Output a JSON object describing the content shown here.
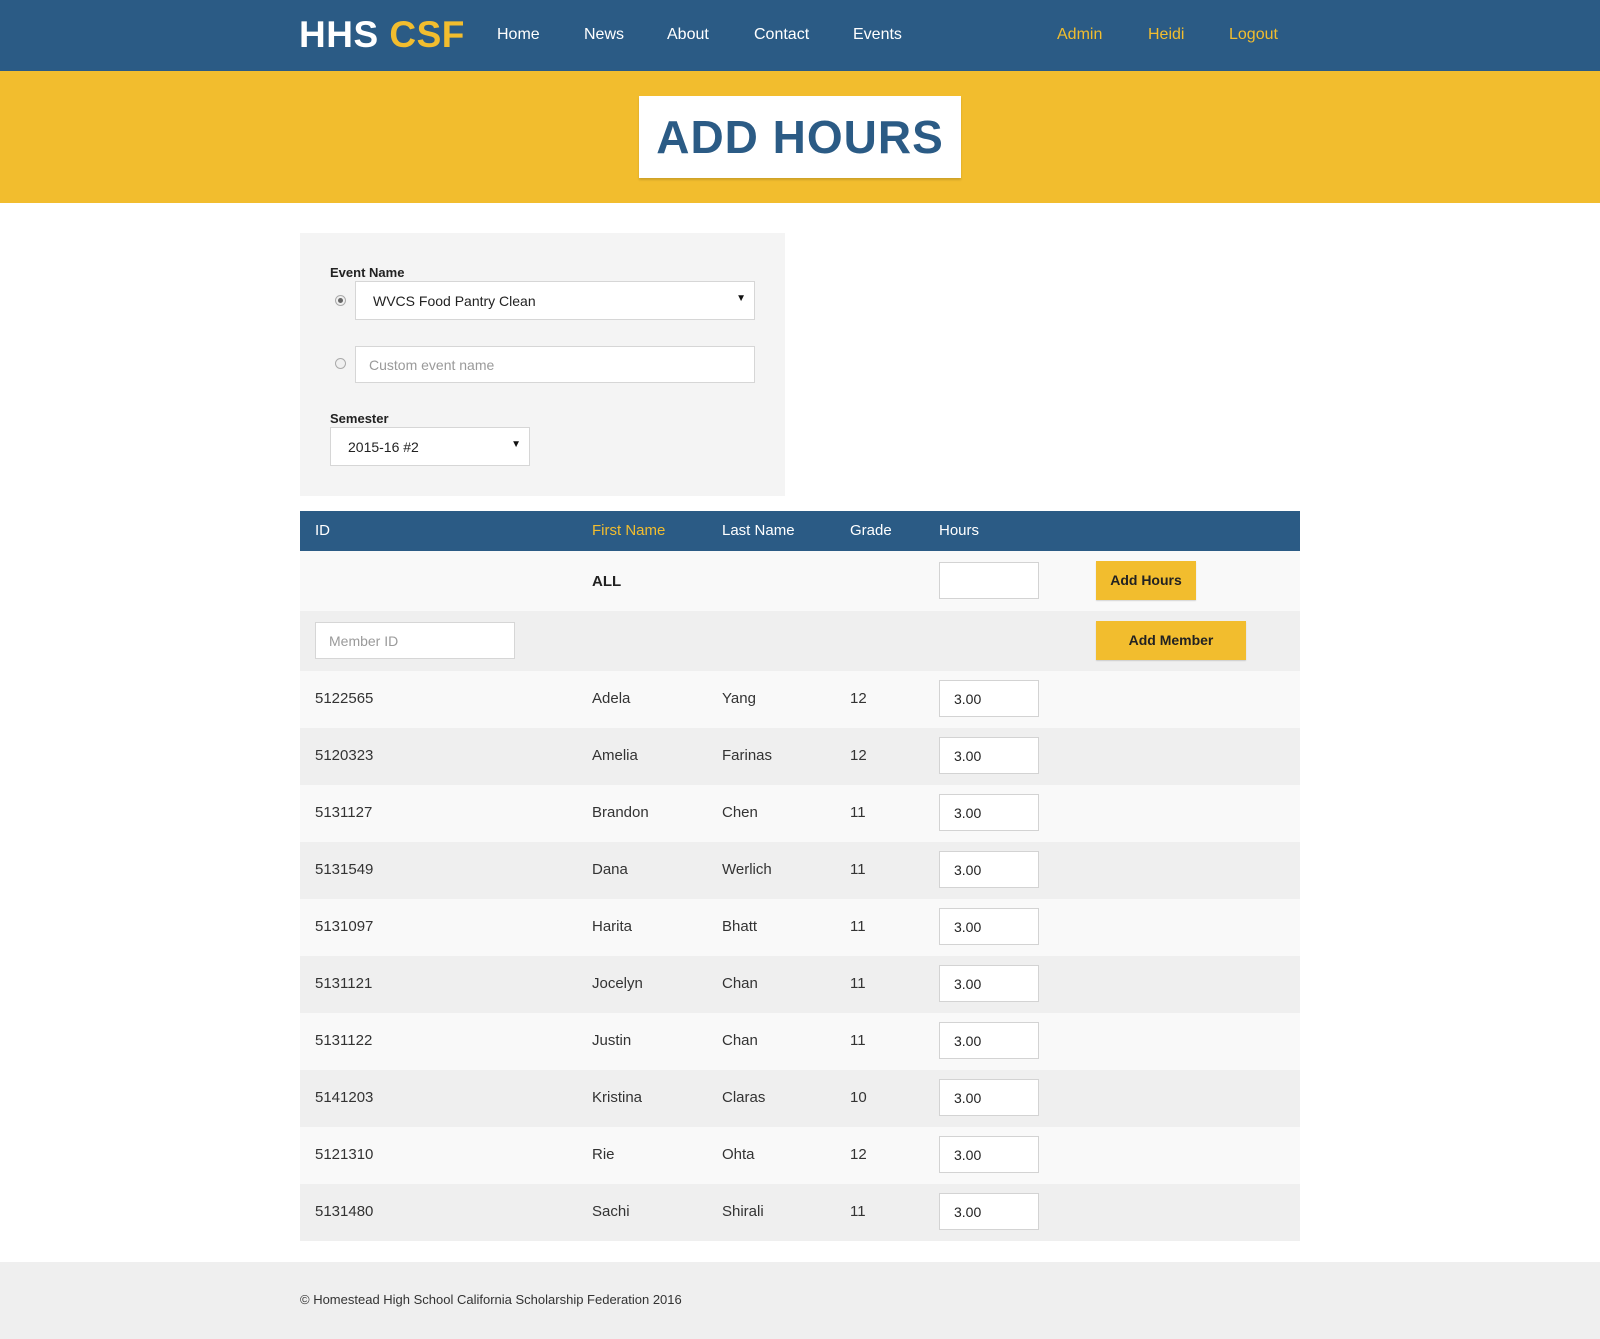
{
  "brand": {
    "part1": "HHS",
    "part2": "CSF"
  },
  "nav": {
    "left": [
      "Home",
      "News",
      "About",
      "Contact",
      "Events"
    ],
    "right": [
      "Admin",
      "Heidi",
      "Logout"
    ]
  },
  "page": {
    "title": "ADD HOURS"
  },
  "form": {
    "event_label": "Event Name",
    "event_selected": "WVCS Food Pantry Clean",
    "custom_event_placeholder": "Custom event name",
    "semester_label": "Semester",
    "semester_selected": "2015-16 #2"
  },
  "table": {
    "headers": {
      "id": "ID",
      "first": "First Name",
      "last": "Last Name",
      "grade": "Grade",
      "hours": "Hours"
    },
    "all_label": "ALL",
    "add_hours_button": "Add Hours",
    "member_id_placeholder": "Member ID",
    "add_member_button": "Add Member",
    "rows": [
      {
        "id": "5122565",
        "first": "Adela",
        "last": "Yang",
        "grade": "12",
        "hours": "3.00"
      },
      {
        "id": "5120323",
        "first": "Amelia",
        "last": "Farinas",
        "grade": "12",
        "hours": "3.00"
      },
      {
        "id": "5131127",
        "first": "Brandon",
        "last": "Chen",
        "grade": "11",
        "hours": "3.00"
      },
      {
        "id": "5131549",
        "first": "Dana",
        "last": "Werlich",
        "grade": "11",
        "hours": "3.00"
      },
      {
        "id": "5131097",
        "first": "Harita",
        "last": "Bhatt",
        "grade": "11",
        "hours": "3.00"
      },
      {
        "id": "5131121",
        "first": "Jocelyn",
        "last": "Chan",
        "grade": "11",
        "hours": "3.00"
      },
      {
        "id": "5131122",
        "first": "Justin",
        "last": "Chan",
        "grade": "11",
        "hours": "3.00"
      },
      {
        "id": "5141203",
        "first": "Kristina",
        "last": "Claras",
        "grade": "10",
        "hours": "3.00"
      },
      {
        "id": "5121310",
        "first": "Rie",
        "last": "Ohta",
        "grade": "12",
        "hours": "3.00"
      },
      {
        "id": "5131480",
        "first": "Sachi",
        "last": "Shirali",
        "grade": "11",
        "hours": "3.00"
      }
    ]
  },
  "footer": {
    "text": "© Homestead High School California Scholarship Federation 2016"
  },
  "colors": {
    "navy": "#2b5b85",
    "gold": "#f2bd2e"
  },
  "icons": {
    "select_caret": "caret-down-icon"
  }
}
